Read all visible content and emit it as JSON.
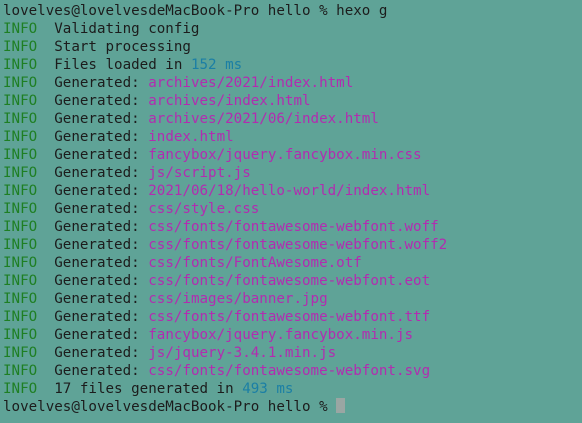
{
  "colors": {
    "background": "#5fa397",
    "text": "#1c1c1c",
    "info_level": "#1e7f23",
    "path": "#b22cb0",
    "number": "#1b7fa5",
    "cursor": "#9aa6a3"
  },
  "prompt": {
    "host": "lovelves@lovelvesdeMacBook-Pro",
    "dir": "hello",
    "symbol": "%",
    "command": "hexo g"
  },
  "output": [
    {
      "level": "INFO",
      "text": "Validating config"
    },
    {
      "level": "INFO",
      "text": "Start processing"
    },
    {
      "level": "INFO",
      "prefix": "Files loaded in",
      "number": "152",
      "unit": "ms"
    },
    {
      "level": "INFO",
      "prefix": "Generated:",
      "path": "archives/2021/index.html"
    },
    {
      "level": "INFO",
      "prefix": "Generated:",
      "path": "archives/index.html"
    },
    {
      "level": "INFO",
      "prefix": "Generated:",
      "path": "archives/2021/06/index.html"
    },
    {
      "level": "INFO",
      "prefix": "Generated:",
      "path": "index.html"
    },
    {
      "level": "INFO",
      "prefix": "Generated:",
      "path": "fancybox/jquery.fancybox.min.css"
    },
    {
      "level": "INFO",
      "prefix": "Generated:",
      "path": "js/script.js"
    },
    {
      "level": "INFO",
      "prefix": "Generated:",
      "path": "2021/06/18/hello-world/index.html"
    },
    {
      "level": "INFO",
      "prefix": "Generated:",
      "path": "css/style.css"
    },
    {
      "level": "INFO",
      "prefix": "Generated:",
      "path": "css/fonts/fontawesome-webfont.woff"
    },
    {
      "level": "INFO",
      "prefix": "Generated:",
      "path": "css/fonts/fontawesome-webfont.woff2"
    },
    {
      "level": "INFO",
      "prefix": "Generated:",
      "path": "css/fonts/FontAwesome.otf"
    },
    {
      "level": "INFO",
      "prefix": "Generated:",
      "path": "css/fonts/fontawesome-webfont.eot"
    },
    {
      "level": "INFO",
      "prefix": "Generated:",
      "path": "css/images/banner.jpg"
    },
    {
      "level": "INFO",
      "prefix": "Generated:",
      "path": "css/fonts/fontawesome-webfont.ttf"
    },
    {
      "level": "INFO",
      "prefix": "Generated:",
      "path": "fancybox/jquery.fancybox.min.js"
    },
    {
      "level": "INFO",
      "prefix": "Generated:",
      "path": "js/jquery-3.4.1.min.js"
    },
    {
      "level": "INFO",
      "prefix": "Generated:",
      "path": "css/fonts/fontawesome-webfont.svg"
    },
    {
      "level": "INFO",
      "prefix": "17 files generated in",
      "number": "493",
      "unit": "ms"
    }
  ],
  "final_prompt": {
    "host": "lovelves@lovelvesdeMacBook-Pro",
    "dir": "hello",
    "symbol": "%"
  }
}
